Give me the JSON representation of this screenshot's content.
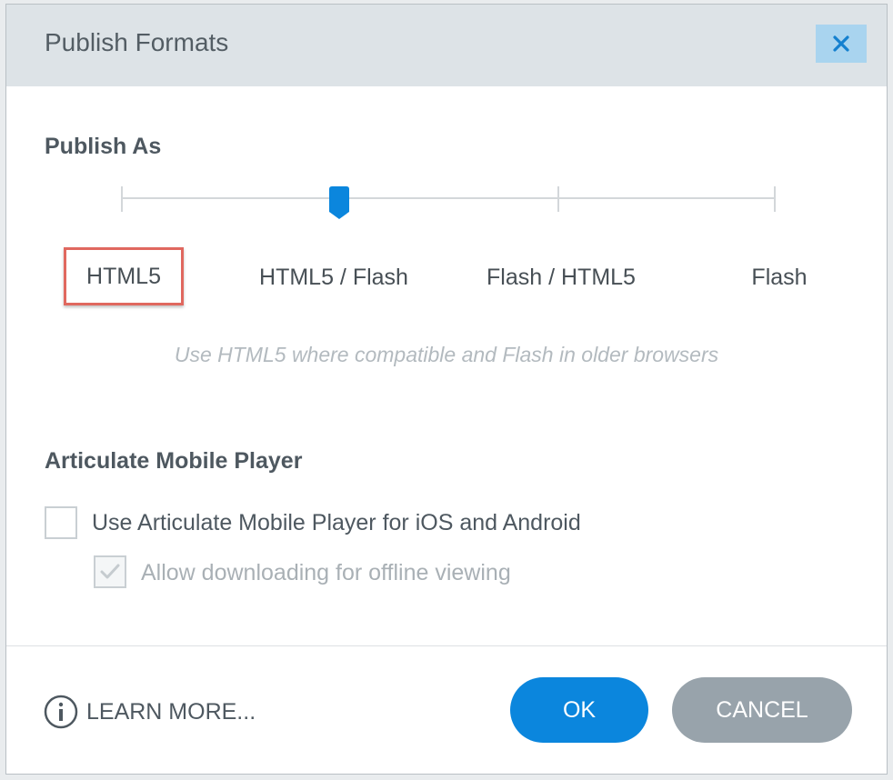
{
  "dialog": {
    "title": "Publish Formats",
    "close_icon": "close-icon"
  },
  "publish_as": {
    "heading": "Publish As",
    "options": [
      "HTML5",
      "HTML5 / Flash",
      "Flash / HTML5",
      "Flash"
    ],
    "selected_index": 1,
    "description": "Use HTML5 where compatible and Flash in older browsers"
  },
  "mobile": {
    "heading": "Articulate Mobile Player",
    "use_player_label": "Use Articulate Mobile Player for iOS and Android",
    "use_player_checked": false,
    "allow_download_label": "Allow downloading for offline viewing",
    "allow_download_checked": true,
    "allow_download_enabled": false
  },
  "footer": {
    "learn_more_label": "LEARN MORE...",
    "info_icon": "info-icon",
    "ok_label": "OK",
    "cancel_label": "CANCEL"
  },
  "colors": {
    "accent": "#0b86dd",
    "cancel": "#98a3ab",
    "highlight": "#e0685f"
  }
}
